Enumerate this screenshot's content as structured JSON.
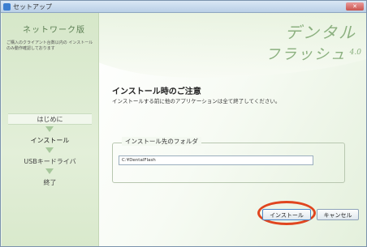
{
  "window": {
    "title": "セットアップ"
  },
  "sidebar": {
    "edition": "ネットワーク版",
    "note": "ご購入のクライアント台数以内の インストールのみ動作確認しております",
    "steps": [
      {
        "label": "はじめに",
        "active": false
      },
      {
        "label": "インストール",
        "active": true
      },
      {
        "label": "USBキードライバ",
        "active": false
      },
      {
        "label": "終了",
        "active": false
      }
    ]
  },
  "logo": {
    "line1": "デンタル",
    "line2": "フラッシュ",
    "version": "4.0"
  },
  "main": {
    "heading": "インストール時のご注意",
    "subtext": "インストールする前に他のアプリケーションは全て終了してください。",
    "folder_label": "インストール先のフォルダ",
    "folder_path": "C:¥DentalFlash"
  },
  "buttons": {
    "install": "インストール",
    "cancel": "キャンセル"
  },
  "colors": {
    "highlight_ring": "#e0451f",
    "accent_green": "#8bb07f"
  }
}
